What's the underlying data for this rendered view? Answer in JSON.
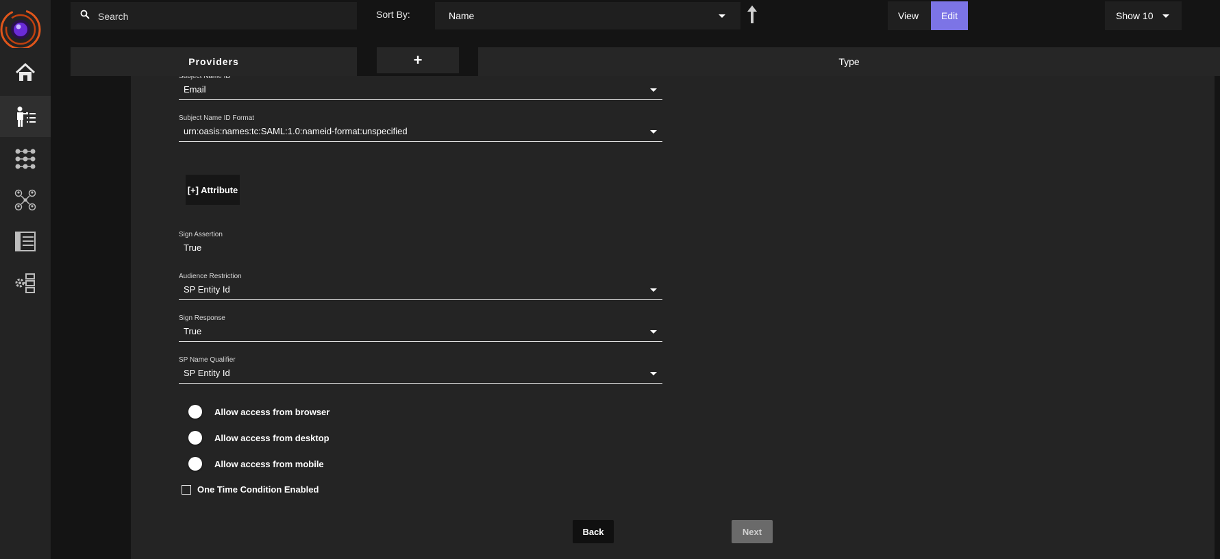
{
  "colors": {
    "accent": "#7c74e6",
    "background": "#141414",
    "panel": "#242424",
    "sidebar": "#232323"
  },
  "sidebar": {
    "items": [
      {
        "icon": "home-icon"
      },
      {
        "icon": "user-list-icon",
        "active": true
      },
      {
        "icon": "grid-dots-icon"
      },
      {
        "icon": "user-network-icon"
      },
      {
        "icon": "list-panel-icon"
      },
      {
        "icon": "gear-list-icon"
      }
    ]
  },
  "toolbar": {
    "search_placeholder": "Search",
    "sort_label": "Sort By:",
    "sort_value": "Name",
    "view_label": "View",
    "edit_label": "Edit",
    "show_value": "Show 10"
  },
  "table_header": {
    "providers": "Providers",
    "add": "+",
    "type": "Type"
  },
  "form": {
    "subject_name_id": {
      "label": "Subject Name ID",
      "value": "Email"
    },
    "subject_name_id_format": {
      "label": "Subject Name ID Format",
      "value": "urn:oasis:names:tc:SAML:1.0:nameid-format:unspecified"
    },
    "add_attribute": "[+] Attribute",
    "sign_assertion": {
      "label": "Sign Assertion",
      "value": "True"
    },
    "audience_restriction": {
      "label": "Audience Restriction",
      "value": "SP Entity Id"
    },
    "sign_response": {
      "label": "Sign Response",
      "value": "True"
    },
    "sp_name_qualifier": {
      "label": "SP Name Qualifier",
      "value": "SP Entity Id"
    },
    "toggles": [
      {
        "label": "Allow access from browser",
        "on": false
      },
      {
        "label": "Allow access from desktop",
        "on": false
      },
      {
        "label": "Allow access from mobile",
        "on": false
      }
    ],
    "one_time_condition": {
      "label": "One Time Condition Enabled",
      "checked": false
    },
    "back_label": "Back",
    "next_label": "Next"
  }
}
